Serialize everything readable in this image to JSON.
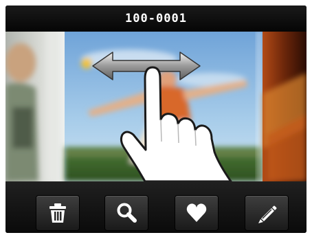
{
  "title": "100-0001",
  "toolbar": {
    "buttons": [
      {
        "id": "delete",
        "icon": "trash-icon"
      },
      {
        "id": "zoom",
        "icon": "magnifier-icon"
      },
      {
        "id": "favorite",
        "icon": "heart-icon"
      },
      {
        "id": "edit",
        "icon": "pencil-icon"
      }
    ]
  },
  "gesture": {
    "icon": "swipe-hand-icon",
    "arrow_icon": "double-arrow-icon"
  },
  "colors": {
    "bar_bg": "#0b0b0b",
    "title_text": "#ffffff",
    "button_bg": "#2e2e2e",
    "icon_fill": "#ffffff"
  }
}
